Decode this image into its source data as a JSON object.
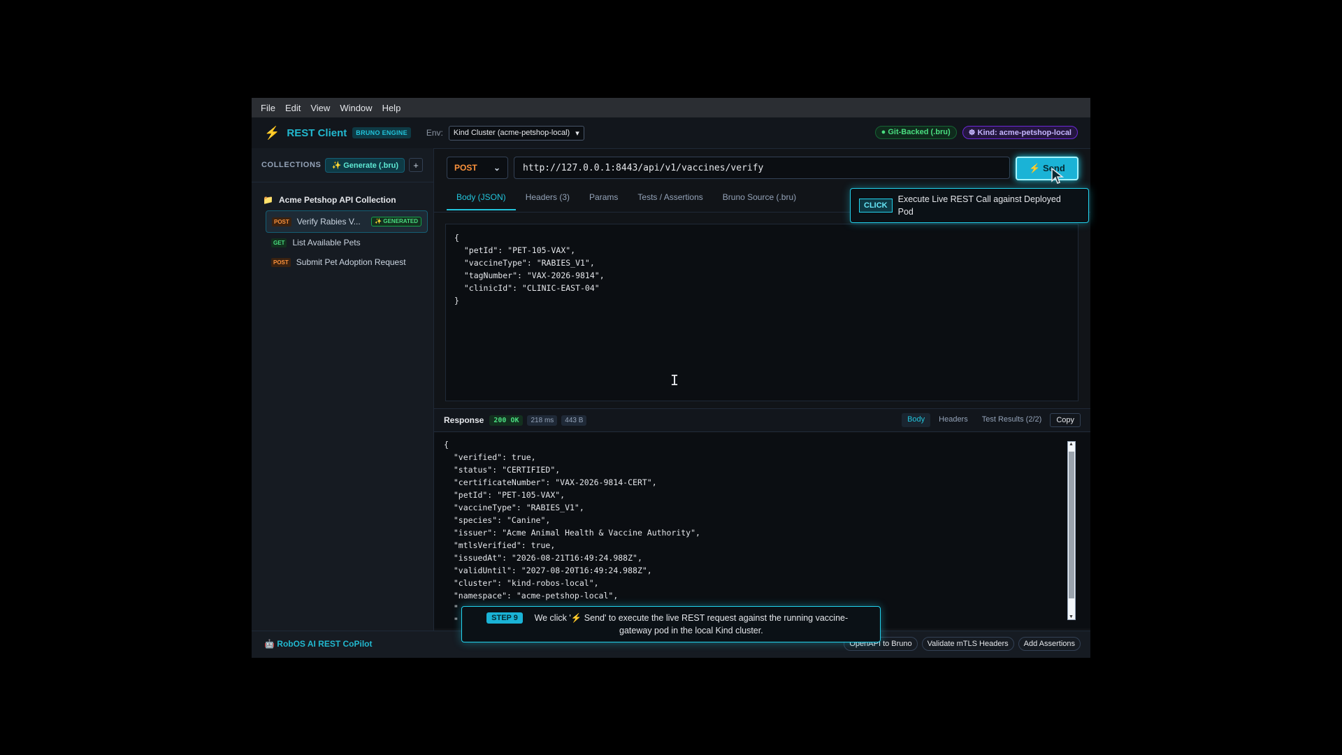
{
  "menu": [
    "File",
    "Edit",
    "View",
    "Window",
    "Help"
  ],
  "header": {
    "title": "REST Client",
    "engine_badge": "BRUNO ENGINE",
    "env_label": "Env:",
    "env_value": "Kind Cluster (acme-petshop-local)",
    "git_badge": "● Git-Backed (.bru)",
    "kind_badge": "☸ Kind: acme-petshop-local"
  },
  "sidebar": {
    "collections_label": "COLLECTIONS",
    "generate_label": "✨ Generate (.bru)",
    "add_label": "+",
    "folder_name": "Acme Petshop API Collection",
    "requests": [
      {
        "method": "POST",
        "name": "Verify Rabies V...",
        "tag": "✨ GENERATED"
      },
      {
        "method": "GET",
        "name": "List Available Pets"
      },
      {
        "method": "POST",
        "name": "Submit Pet Adoption Request"
      }
    ]
  },
  "request": {
    "method": "POST",
    "url": "http://127.0.0.1:8443/api/v1/vaccines/verify",
    "send_label": "⚡ Send",
    "tabs": [
      "Body (JSON)",
      "Headers (3)",
      "Params",
      "Tests / Assertions",
      "Bruno Source (.bru)"
    ],
    "body": "{\n  \"petId\": \"PET-105-VAX\",\n  \"vaccineType\": \"RABIES_V1\",\n  \"tagNumber\": \"VAX-2026-9814\",\n  \"clinicId\": \"CLINIC-EAST-04\"\n}"
  },
  "response": {
    "label": "Response",
    "status": "200 OK",
    "time": "218 ms",
    "size": "443 B",
    "tabs": [
      "Body",
      "Headers",
      "Test Results (2/2)",
      "Copy"
    ],
    "body": "{\n  \"verified\": true,\n  \"status\": \"CERTIFIED\",\n  \"certificateNumber\": \"VAX-2026-9814-CERT\",\n  \"petId\": \"PET-105-VAX\",\n  \"vaccineType\": \"RABIES_V1\",\n  \"species\": \"Canine\",\n  \"issuer\": \"Acme Animal Health & Vaccine Authority\",\n  \"mtlsVerified\": true,\n  \"issuedAt\": \"2026-08-21T16:49:24.988Z\",\n  \"validUntil\": \"2027-08-20T16:49:24.988Z\",\n  \"cluster\": \"kind-robos-local\",\n  \"namespace\": \"acme-petshop-local\",\n  \"\n  \""
  },
  "footer": {
    "copilot": "🤖 RobOS AI REST CoPilot",
    "buttons": [
      "OpenAPI to Bruno",
      "Validate mTLS Headers",
      "Add Assertions"
    ]
  },
  "click_tooltip": {
    "badge": "CLICK",
    "text": "Execute Live REST Call against Deployed Pod"
  },
  "step_tooltip": {
    "badge": "STEP 9",
    "text": "We click '⚡ Send' to execute the live REST request against the running vaccine-gateway pod in the local Kind cluster."
  }
}
